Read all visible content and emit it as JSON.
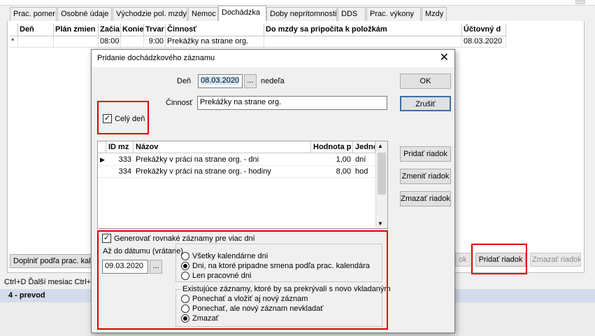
{
  "tabs": [
    "Prac. pomer",
    "Osobné údaje",
    "Východzie pol. mzdy",
    "Nemoc",
    "Dochádzka",
    "Doby neprítomnosti",
    "DDS",
    "Prac. výkony",
    "Mzdy"
  ],
  "grid": {
    "headers": [
      "Deň",
      "Plán zmien",
      "Začia",
      "Konie",
      "Trvar",
      "Činnosť",
      "Do mzdy sa pripočíta k položkám",
      "Účtovný d"
    ],
    "row": {
      "marker": "*",
      "zaciatok": "08:00",
      "trvanie": "9:00",
      "cinnost": "Prekážky na strane org.",
      "uctovny": "08.03.2020"
    }
  },
  "bottom": {
    "dopln": "Doplniť podľa prac. kalendára",
    "ok_hidden": "ok",
    "pridat": "Pridať riadok",
    "zmazat": "Zmazať riadok"
  },
  "status": "Ctrl+D Ďalší mesiac   Ctrl+",
  "employee": "4 - prevod",
  "dialog": {
    "title": "Pridanie dochádzkového záznamu",
    "close": "✕",
    "den_label": "Deň",
    "den_value": "08.03.2020",
    "ellipsis": "...",
    "weekday": "nedeľa",
    "cinnost_label": "Činnosť",
    "cinnost_value": "Prekážky na strane org.",
    "cely_den": "Celý deň",
    "ok": "OK",
    "zrusit": "Zrušiť",
    "pridat_riadok": "Pridať riadok",
    "zmenit_riadok": "Zmeniť riadok",
    "zmazat_riadok": "Zmazať riadok",
    "table": {
      "headers": [
        "ID mz",
        "Názov",
        "Hodnota p",
        "Jedno"
      ],
      "rows": [
        {
          "marker": "▶",
          "id": "333",
          "nazov": "Prekážky v práci na strane org. - dni",
          "hodnota": "1,00",
          "jednotka": "dní"
        },
        {
          "marker": "",
          "id": "334",
          "nazov": "Prekážky v práci na strane org. - hodiny",
          "hodnota": "8,00",
          "jednotka": "hod"
        }
      ]
    },
    "generovat": "Generovať rovnaké záznamy pre viac dní",
    "az_do": "Až do dátumu (vrátane)",
    "az_do_value": "09.03.2020",
    "radio_group1": [
      "Všetky kalendárne dni",
      "Dni, na ktoré pripadne smena podľa prac. kalendára",
      "Len pracovné dni"
    ],
    "group2_title": "Existujúce záznamy, ktoré by sa prekrývali s novo vkladaným",
    "radio_group2": [
      "Ponechať a vložiť aj nový záznam",
      "Ponechať, ale nový záznam nevkladať",
      "Zmazať"
    ]
  }
}
